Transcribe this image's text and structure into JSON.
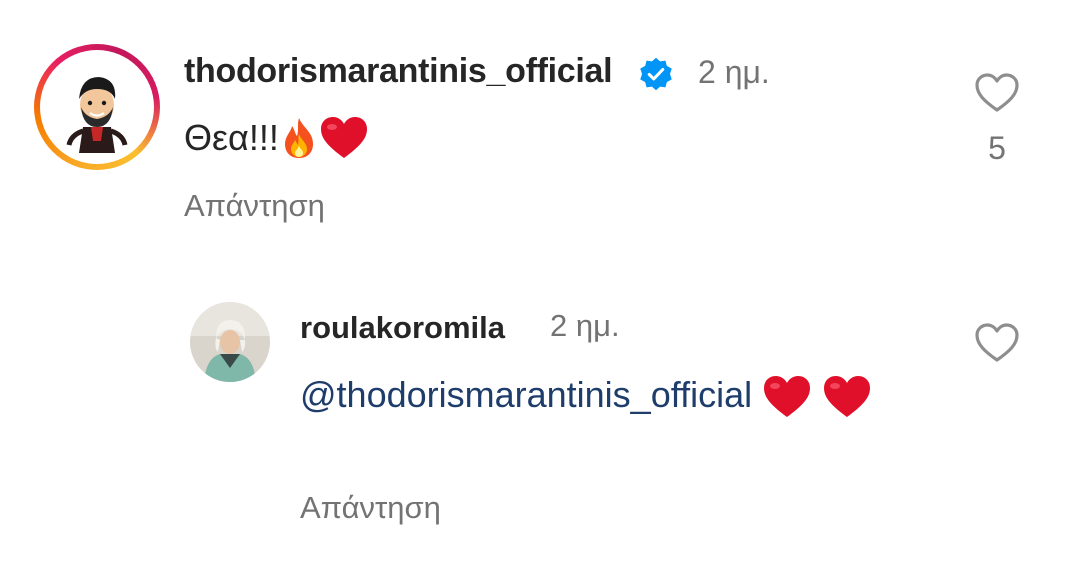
{
  "comments": [
    {
      "username": "thodorismarantinis_official",
      "verified": true,
      "time": "2 ημ.",
      "text": "Θεα!!!",
      "emojis": [
        "fire-emoji",
        "red-heart-emoji"
      ],
      "reply_label": "Απάντηση",
      "likes": "5",
      "avatar_ring": "story-gradient"
    },
    {
      "username": "roulakoromila",
      "verified": false,
      "time": "2 ημ.",
      "mention": "@thodorismarantinis_official",
      "emojis": [
        "red-heart-emoji",
        "red-heart-emoji"
      ],
      "reply_label": "Απάντηση"
    }
  ],
  "colors": {
    "username": "#262626",
    "secondary_text": "#737373",
    "mention": "#1e3d6b",
    "verified_badge": "#0095f6",
    "heart_emoji": "#e0102b"
  },
  "icons": {
    "like": "heart-outline-icon",
    "verified": "verified-badge-icon"
  }
}
